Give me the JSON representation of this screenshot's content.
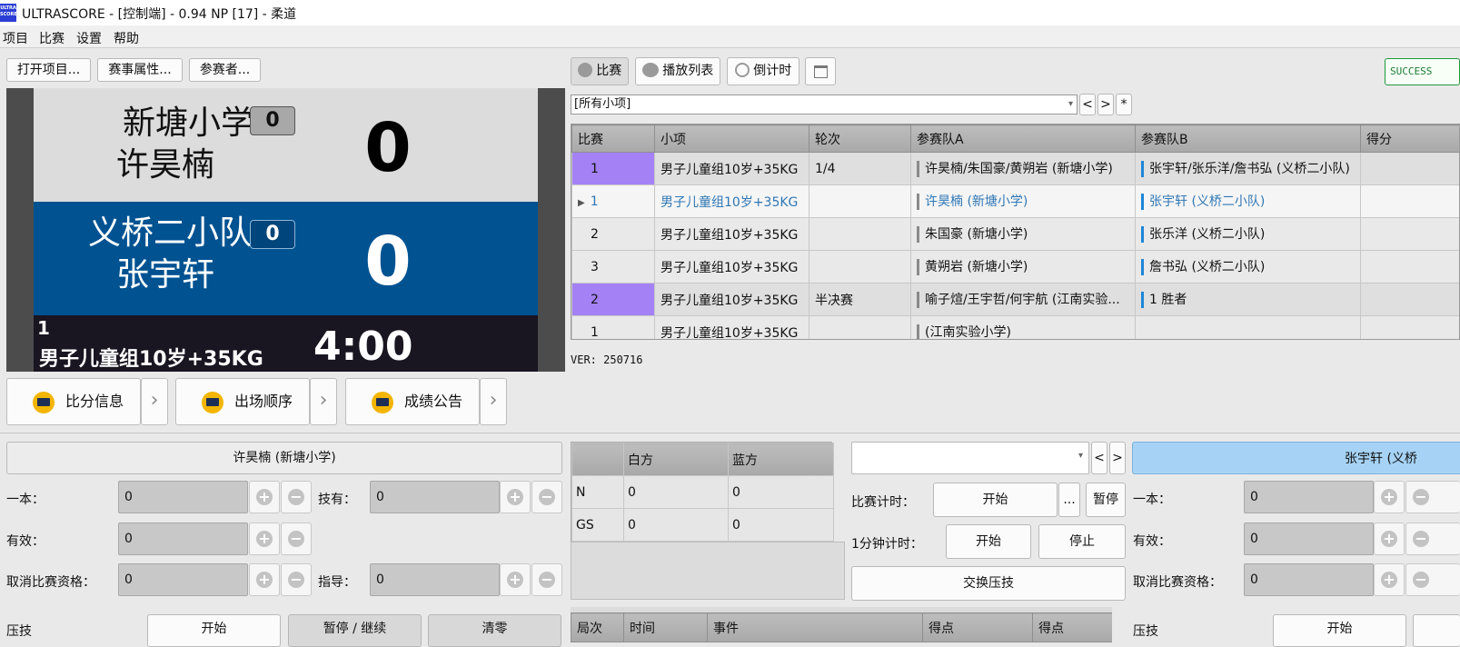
{
  "window": {
    "app_icon_text": "ULTRA SCORE",
    "title": "ULTRASCORE - [控制端] - 0.94 NP [17] - 柔道"
  },
  "menu": [
    "项目",
    "比赛",
    "设置",
    "帮助"
  ],
  "toolbar_left": {
    "open_project": "打开项目...",
    "event_props": "赛事属性...",
    "participants": "参赛者..."
  },
  "toolbar_right": {
    "match": "比赛",
    "playlist": "播放列表",
    "countdown": "倒计时",
    "success": "SUCCESS"
  },
  "filter": {
    "value": "[所有小项]",
    "prev": "<",
    "next": ">",
    "all": "*"
  },
  "scoreboard": {
    "white": {
      "team": "新塘小学",
      "player": "许昊楠",
      "penalty": "0",
      "score": "0"
    },
    "blue": {
      "team": "义桥二小队",
      "player": "张宇轩",
      "penalty": "0",
      "score": "0"
    },
    "footer": {
      "match_no": "1",
      "category": "男子儿童组10岁+35KG",
      "time": "4:00"
    }
  },
  "screen_buttons": {
    "score_info": "比分信息",
    "order": "出场顺序",
    "results": "成绩公告",
    "arrow": "›"
  },
  "table": {
    "columns": [
      "比赛",
      "小项",
      "轮次",
      "参赛队A",
      "参赛队B",
      "得分"
    ],
    "rows": [
      {
        "match": "1",
        "category": "男子儿童组10岁+35KG",
        "round": "1/4",
        "a": "许昊楠/朱国豪/黄朔岩 (新塘小学)",
        "b": "张宇轩/张乐洋/詹书弘 (义桥二小队)",
        "score": ""
      },
      {
        "match": "1",
        "category": "男子儿童组10岁+35KG",
        "round": "",
        "a": "许昊楠 (新塘小学)",
        "b": "张宇轩 (义桥二小队)",
        "score": ""
      },
      {
        "match": "2",
        "category": "男子儿童组10岁+35KG",
        "round": "",
        "a": "朱国豪 (新塘小学)",
        "b": "张乐洋 (义桥二小队)",
        "score": ""
      },
      {
        "match": "3",
        "category": "男子儿童组10岁+35KG",
        "round": "",
        "a": "黄朔岩 (新塘小学)",
        "b": "詹书弘 (义桥二小队)",
        "score": ""
      },
      {
        "match": "2",
        "category": "男子儿童组10岁+35KG",
        "round": "半决赛",
        "a": "喻子煊/王宇哲/何宇航 (江南实验...",
        "b": "1 胜者",
        "score": ""
      },
      {
        "match": "1",
        "category": "男子儿童组10岁+35KG",
        "round": "",
        "a": " (江南实验小学)",
        "b": "",
        "score": ""
      }
    ]
  },
  "version": "VER: 250716",
  "left_panel": {
    "player": "许昊楠 (新塘小学)",
    "ippon_label": "一本：",
    "ippon": "0",
    "waza_label": "技有：",
    "waza": "0",
    "yuko_label": "有效：",
    "yuko": "0",
    "hansoku_label": "取消比赛资格：",
    "hansoku": "0",
    "shido_label": "指导：",
    "shido": "0",
    "osae_label": "压技",
    "b1": "开始",
    "b2": "暂停 / 继续",
    "b3": "清零"
  },
  "stats": {
    "cols": [
      "",
      "白方",
      "蓝方"
    ],
    "rows": [
      [
        "N",
        "0",
        "0"
      ],
      [
        "GS",
        "0",
        "0"
      ]
    ]
  },
  "center_panel": {
    "select_value": "",
    "prev": "<",
    "next": ">",
    "match_timer_label": "比赛计时：",
    "start": "开始",
    "more": "...",
    "pause": "暂停",
    "minute_timer_label": "1分钟计时：",
    "start2": "开始",
    "stop": "停止",
    "swap": "交换压技"
  },
  "events_cols": [
    "局次",
    "时间",
    "事件",
    "得点",
    "得点"
  ],
  "right_panel": {
    "player": "张宇轩 (义桥",
    "ippon_label": "一本：",
    "ippon": "0",
    "yuko_label": "有效：",
    "yuko": "0",
    "hansoku_label": "取消比赛资格：",
    "hansoku": "0",
    "osae_label": "压技",
    "start": "开始"
  },
  "colors": {
    "white_bg": "#dcdcdc",
    "blue_bg": "#005291",
    "dark_bg": "#191521",
    "purple": "#a482f5",
    "selected_text": "#2f77b5",
    "right_header": "#a6d3f5"
  }
}
